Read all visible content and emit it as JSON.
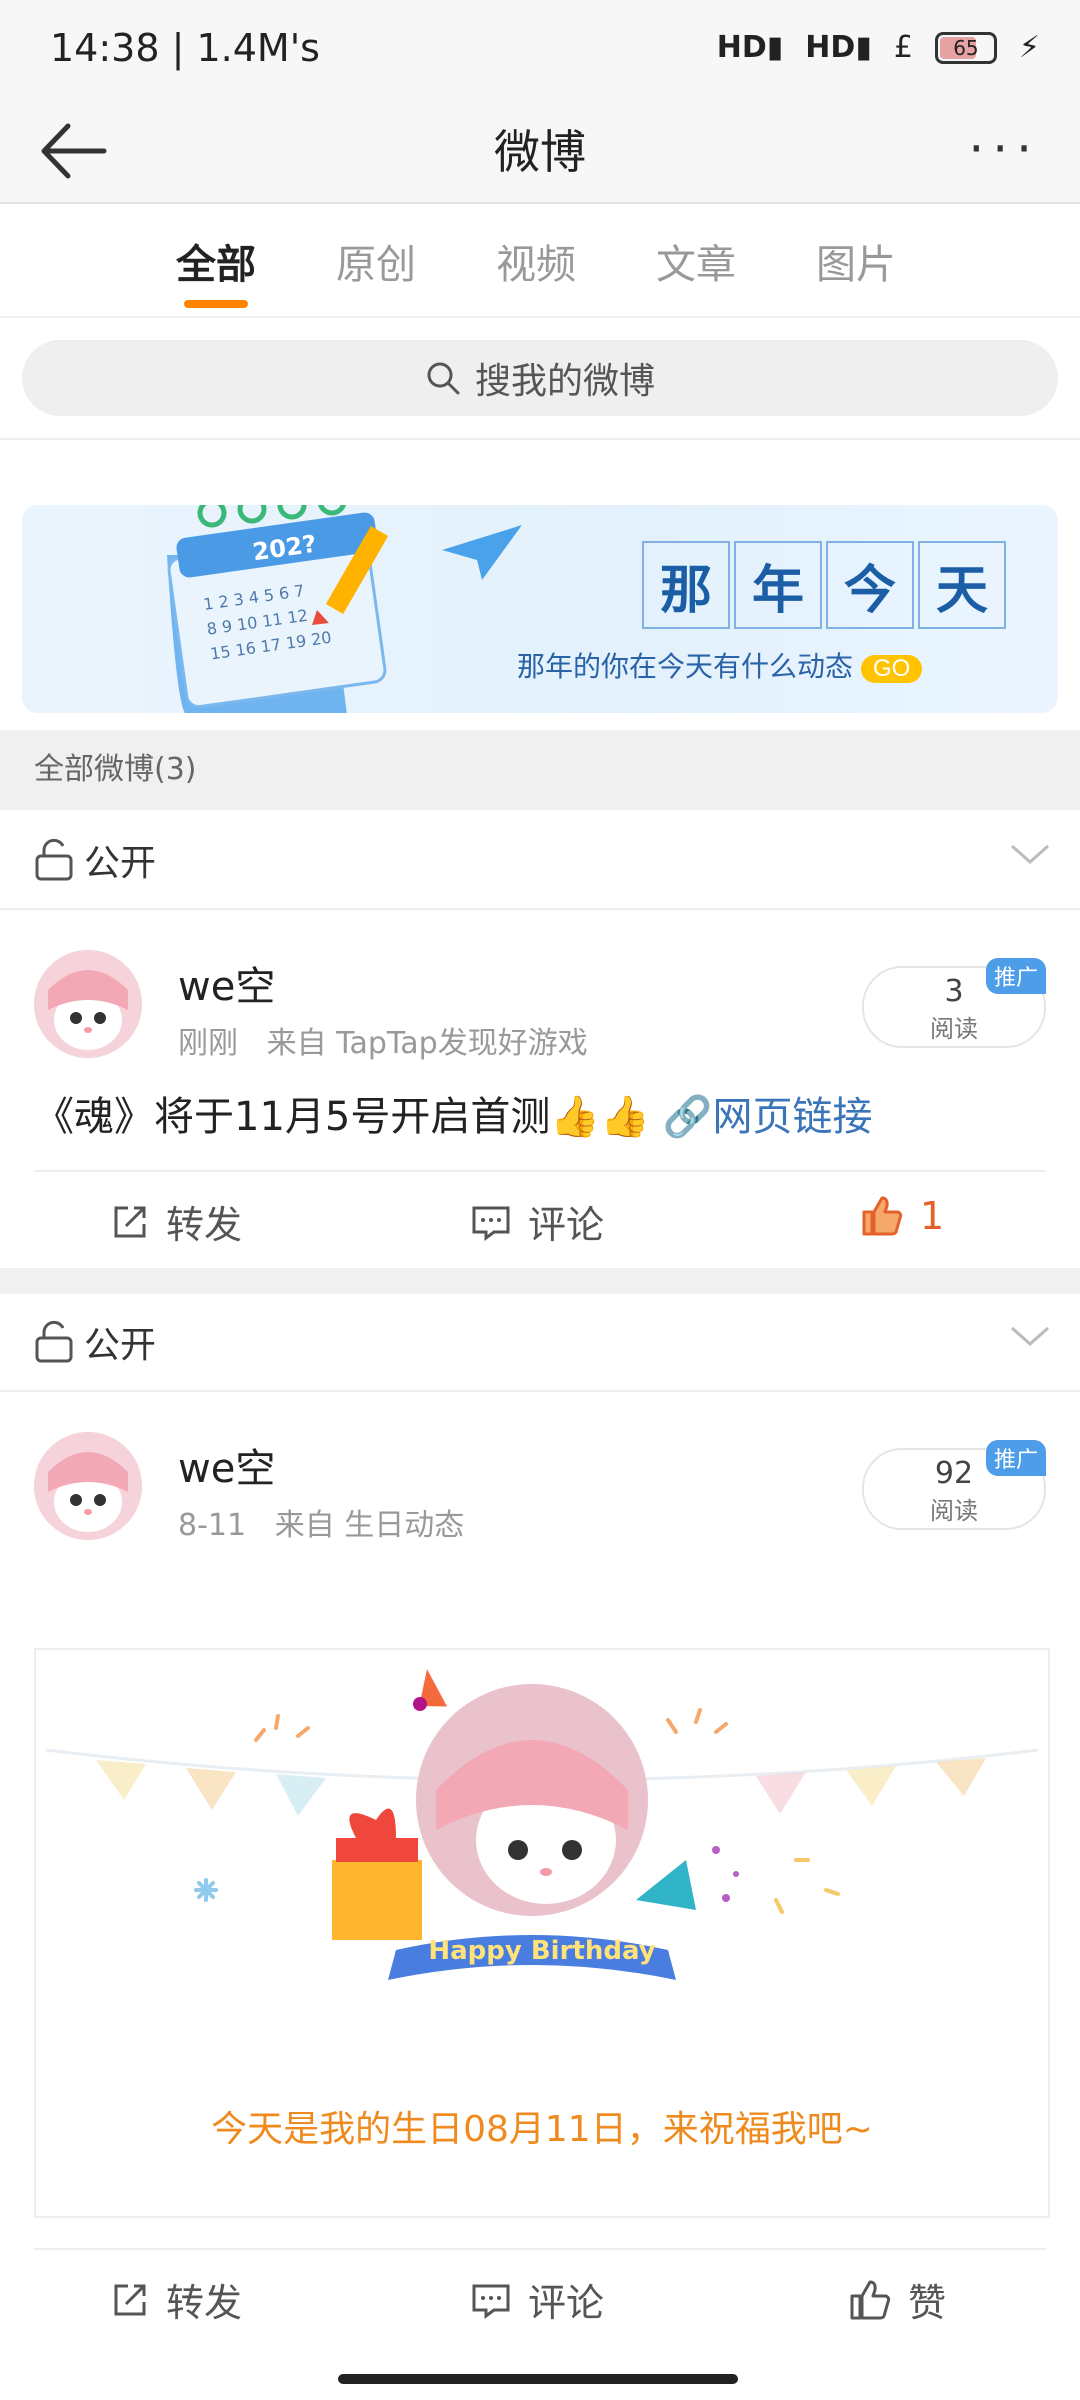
{
  "status": {
    "time": "14:38 | 1.4M's",
    "battery": "65",
    "signal1": "HD",
    "signal2": "HD",
    "currency": "£"
  },
  "nav": {
    "title": "微博"
  },
  "tabs": [
    "全部",
    "原创",
    "视频",
    "文章",
    "图片"
  ],
  "search": {
    "placeholder": "搜我的微博"
  },
  "banner": {
    "title_chars": [
      "那",
      "年",
      "今",
      "天"
    ],
    "subtitle": "那年的你在今天有什么动态",
    "go": "GO",
    "year": "202?"
  },
  "section": {
    "label": "全部微博(3)"
  },
  "posts": [
    {
      "privacy": "公开",
      "user": "we空",
      "time": "刚刚",
      "source": "来自 TapTap发现好游戏",
      "reads": "3",
      "reads_label": "阅读",
      "promo": "推广",
      "text": "《魂》将于11月5号开启首测👍👍",
      "link": "网页链接",
      "actions": {
        "repost": "转发",
        "comment": "评论",
        "like": "1"
      }
    },
    {
      "privacy": "公开",
      "user": "we空",
      "time": "8-11",
      "source": "来自 生日动态",
      "reads": "92",
      "reads_label": "阅读",
      "promo": "推广",
      "card_banner": "Happy Birthday",
      "card_text": "今天是我的生日08月11日，来祝福我吧~",
      "actions": {
        "repost": "转发",
        "comment": "评论",
        "like": "赞"
      }
    }
  ],
  "colors": {
    "accent": "#ff8200",
    "link": "#3a74b9",
    "like": "#e2622a"
  }
}
